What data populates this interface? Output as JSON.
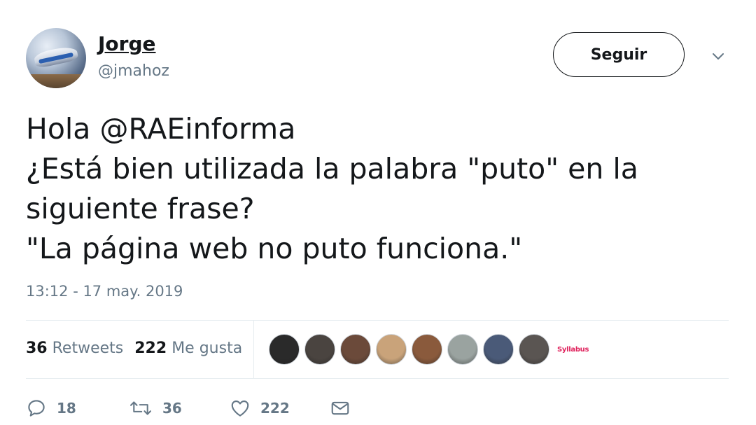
{
  "user": {
    "name": "Jorge",
    "handle": "@jmahoz"
  },
  "follow_button": {
    "label": "Seguir"
  },
  "tweet": {
    "lines": [
      "Hola @RAEinforma",
      "¿Está bien utilizada la palabra \"puto\" en la",
      "siguiente frase?",
      "\"La página web no puto funciona.\""
    ],
    "timestamp": "13:12 - 17 may. 2019"
  },
  "stats": {
    "retweets_count": "36",
    "retweets_label": "Retweets",
    "likes_count": "222",
    "likes_label": "Me gusta"
  },
  "likers": {
    "avatar_colors": [
      "#2a2a2a",
      "#4a4440",
      "#6b4a3a",
      "#c9a37a",
      "#8a5a3c",
      "#9aa3a0",
      "#4a5a78",
      "#5a5552"
    ],
    "extra_label": "Syllabus"
  },
  "actions": {
    "reply_count": "18",
    "retweet_count": "36",
    "like_count": "222"
  },
  "colors": {
    "text": "#14171a",
    "secondary": "#657786",
    "divider": "#e6ecf0"
  }
}
